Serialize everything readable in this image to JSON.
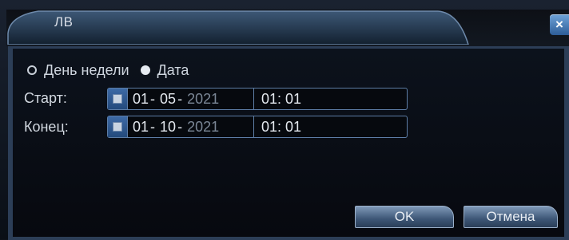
{
  "window": {
    "title": "ЛВ",
    "close_symbol": "×"
  },
  "mode": {
    "options": [
      {
        "label": "День недели",
        "selected": false
      },
      {
        "label": "Дата",
        "selected": true
      }
    ]
  },
  "start": {
    "label": "Старт:",
    "day": "01",
    "month": "05",
    "year": "2021",
    "time": "01: 01"
  },
  "end": {
    "label": "Конец:",
    "day": "01",
    "month": "10",
    "year": "2021",
    "time": "01: 01"
  },
  "buttons": {
    "ok": "OK",
    "cancel": "Отмена"
  },
  "icons": {
    "calendar": "calendar-icon",
    "close": "close-icon"
  },
  "colors": {
    "accent": "#5d7da6",
    "title_text": "#d8dde6",
    "year_text": "#7b8796"
  }
}
